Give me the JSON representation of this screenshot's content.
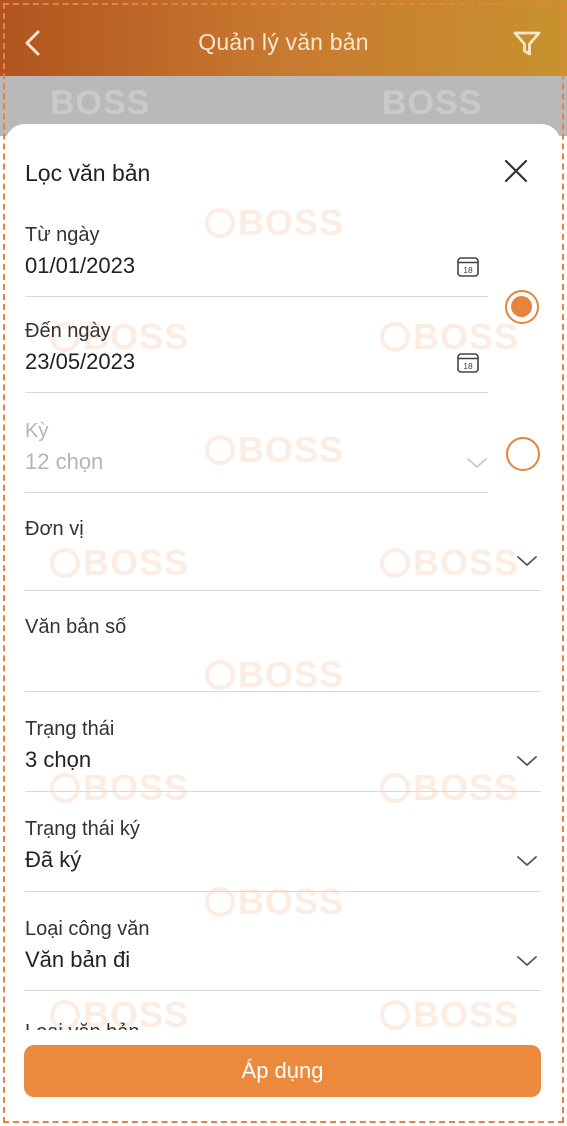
{
  "header": {
    "title": "Quản lý văn bản"
  },
  "watermark": {
    "text": "BOSS"
  },
  "sheet": {
    "title": "Lọc văn bản"
  },
  "fields": {
    "from_date": {
      "label": "Từ ngày",
      "value": "01/01/2023",
      "calendar_day": "18"
    },
    "to_date": {
      "label": "Đến ngày",
      "value": "23/05/2023",
      "calendar_day": "18"
    },
    "period": {
      "label": "Kỳ",
      "value": "12 chọn"
    },
    "unit": {
      "label": "Đơn vị",
      "value": ""
    },
    "doc_number": {
      "label": "Văn bản số",
      "value": ""
    },
    "status": {
      "label": "Trạng thái",
      "value": "3 chọn"
    },
    "sign_status": {
      "label": "Trạng thái ký",
      "value": "Đã ký"
    },
    "dispatch_type": {
      "label": "Loại công văn",
      "value": "Văn bản đi"
    },
    "doc_type": {
      "label": "Loại văn bản"
    }
  },
  "date_mode": {
    "selected": "date_range"
  },
  "actions": {
    "apply_label": "Áp dụng"
  },
  "colors": {
    "accent": "#e8823c",
    "header_start": "#b1541f",
    "header_end": "#c8922e",
    "button": "#eb8a3d"
  },
  "icons": [
    "back-chevron-icon",
    "filter-icon",
    "close-icon",
    "calendar-icon",
    "chevron-down-icon"
  ]
}
